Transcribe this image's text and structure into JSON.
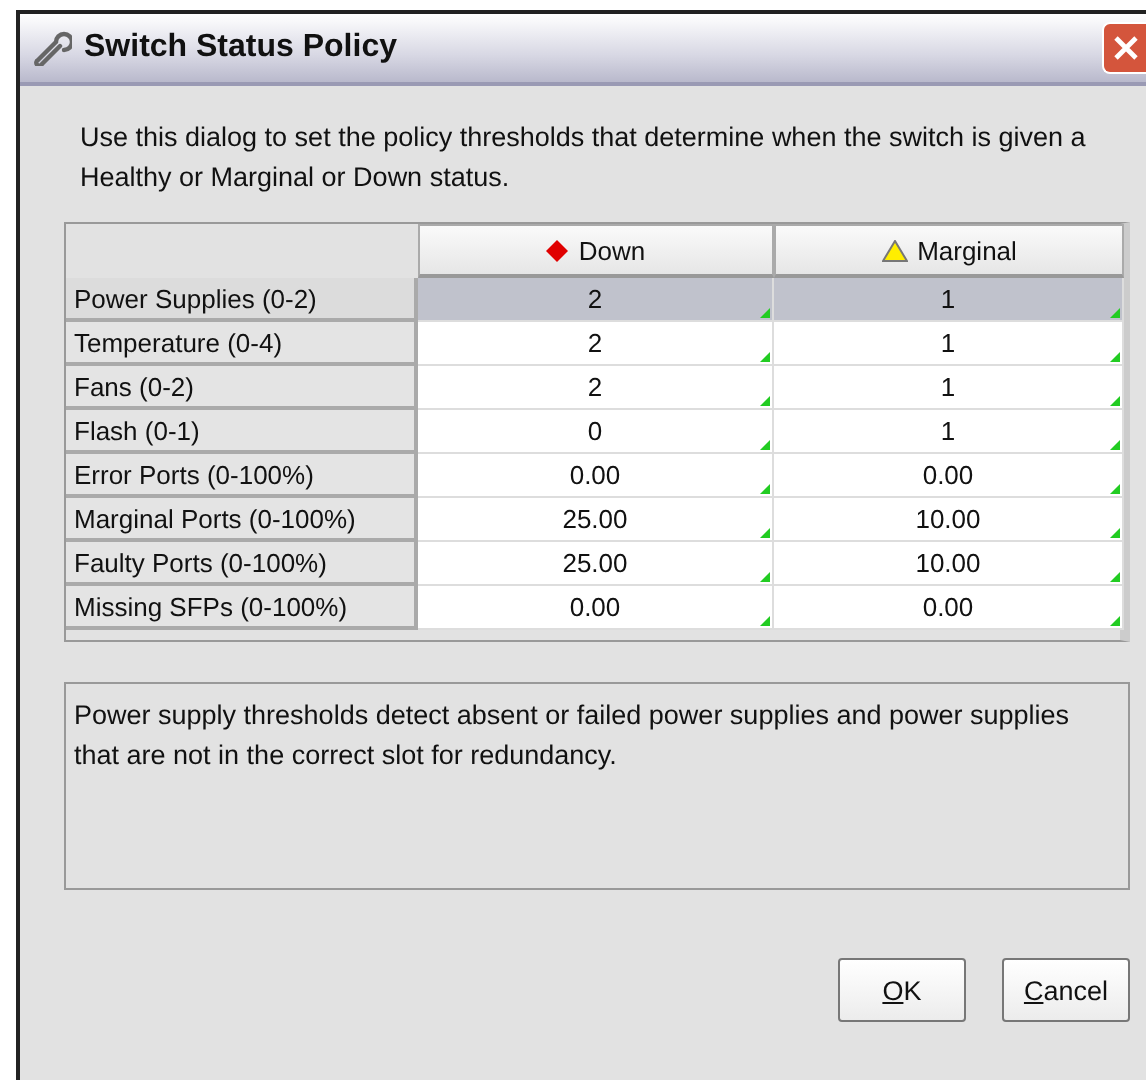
{
  "window": {
    "title": "Switch Status Policy"
  },
  "intro": "Use this dialog to set the policy thresholds that determine when the switch is given a Healthy or Marginal or Down status.",
  "table": {
    "columns": [
      {
        "label": "Down",
        "kind": "down"
      },
      {
        "label": "Marginal",
        "kind": "marginal"
      }
    ],
    "rows": [
      {
        "label": "Power Supplies (0-2)",
        "values": [
          "2",
          "1"
        ],
        "selected": true
      },
      {
        "label": "Temperature (0-4)",
        "values": [
          "2",
          "1"
        ],
        "selected": false
      },
      {
        "label": "Fans (0-2)",
        "values": [
          "2",
          "1"
        ],
        "selected": false
      },
      {
        "label": "Flash (0-1)",
        "values": [
          "0",
          "1"
        ],
        "selected": false
      },
      {
        "label": "Error Ports (0-100%)",
        "values": [
          "0.00",
          "0.00"
        ],
        "selected": false
      },
      {
        "label": "Marginal Ports (0-100%)",
        "values": [
          "25.00",
          "10.00"
        ],
        "selected": false
      },
      {
        "label": "Faulty Ports (0-100%)",
        "values": [
          "25.00",
          "10.00"
        ],
        "selected": false
      },
      {
        "label": "Missing SFPs (0-100%)",
        "values": [
          "0.00",
          "0.00"
        ],
        "selected": false
      }
    ]
  },
  "description": "Power supply thresholds detect absent or failed power supplies and power supplies that are not in the correct slot for redundancy.",
  "buttons": [
    "OK",
    "Cancel"
  ]
}
